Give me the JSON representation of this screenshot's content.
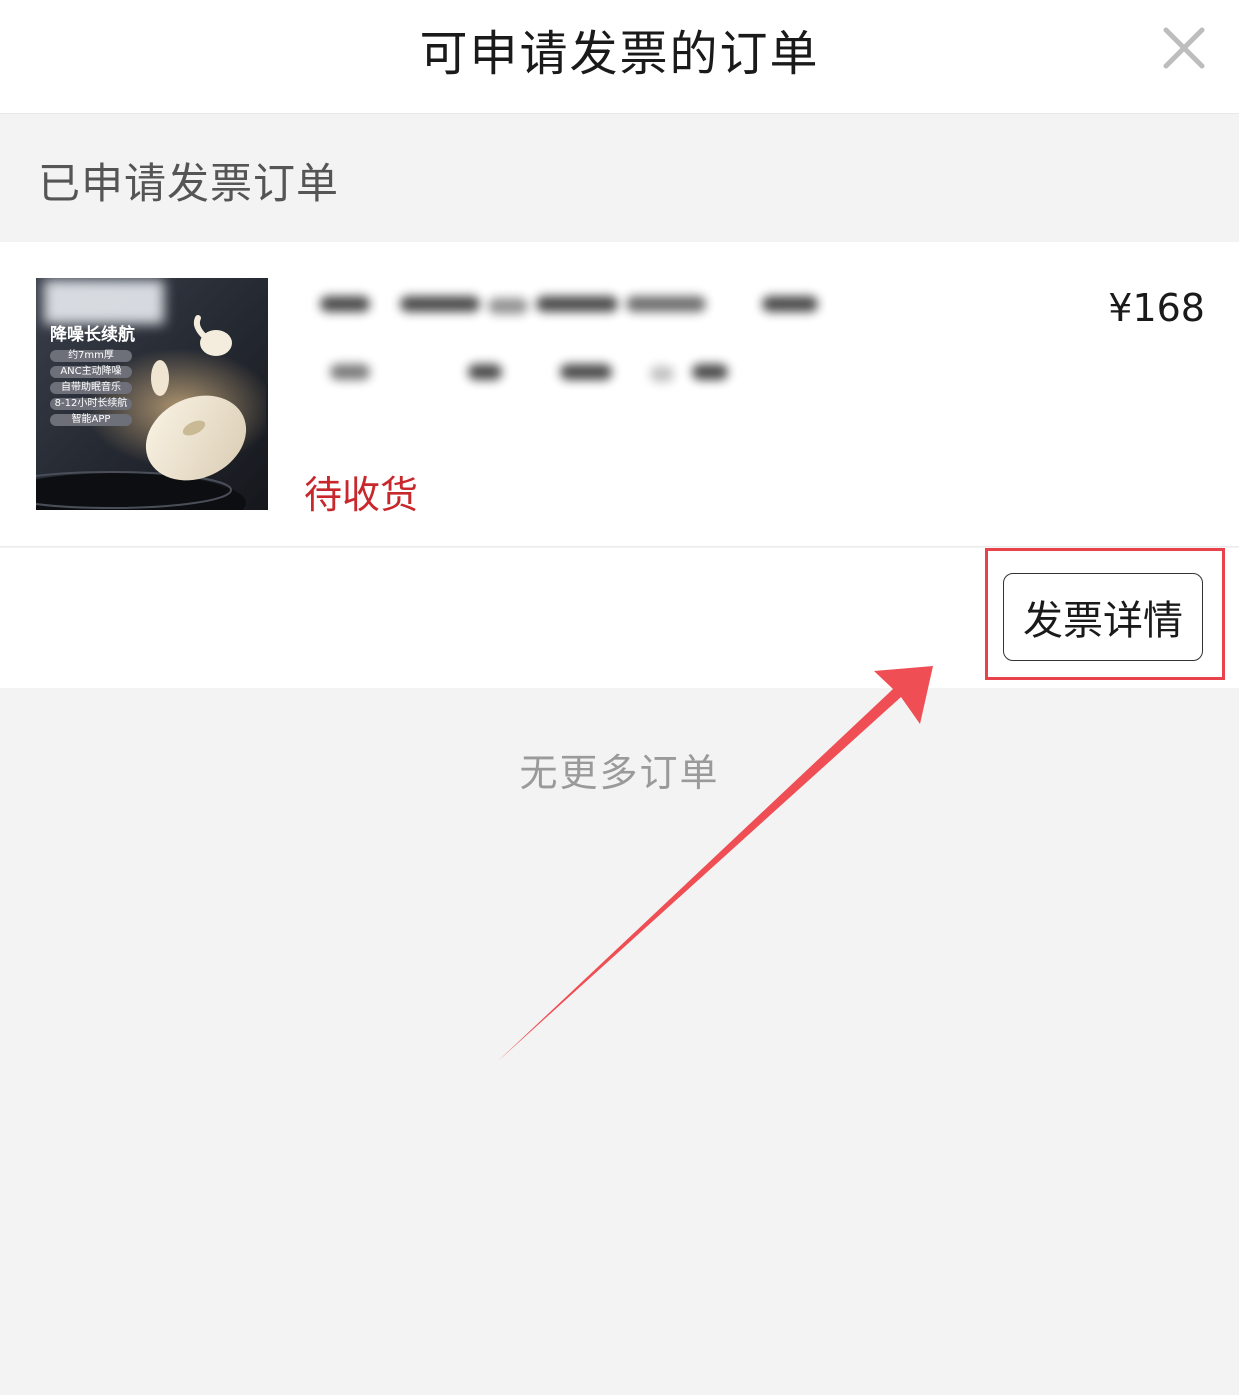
{
  "header": {
    "title": "可申请发票的订单",
    "close_icon": "close-icon"
  },
  "section": {
    "label": "已申请发票订单"
  },
  "order": {
    "thumbnail": {
      "headline": "降噪长续航",
      "features": [
        "约7mm厚",
        "ANC主动降噪",
        "自带助眠音乐",
        "8-12小时长续航",
        "智能APP"
      ]
    },
    "price": "¥168",
    "status": "待收货",
    "invoice_button": "发票详情"
  },
  "footer": {
    "no_more": "无更多订单"
  },
  "colors": {
    "status_red": "#c8282c",
    "highlight_red": "#e8434d",
    "background": "#f3f3f3"
  }
}
